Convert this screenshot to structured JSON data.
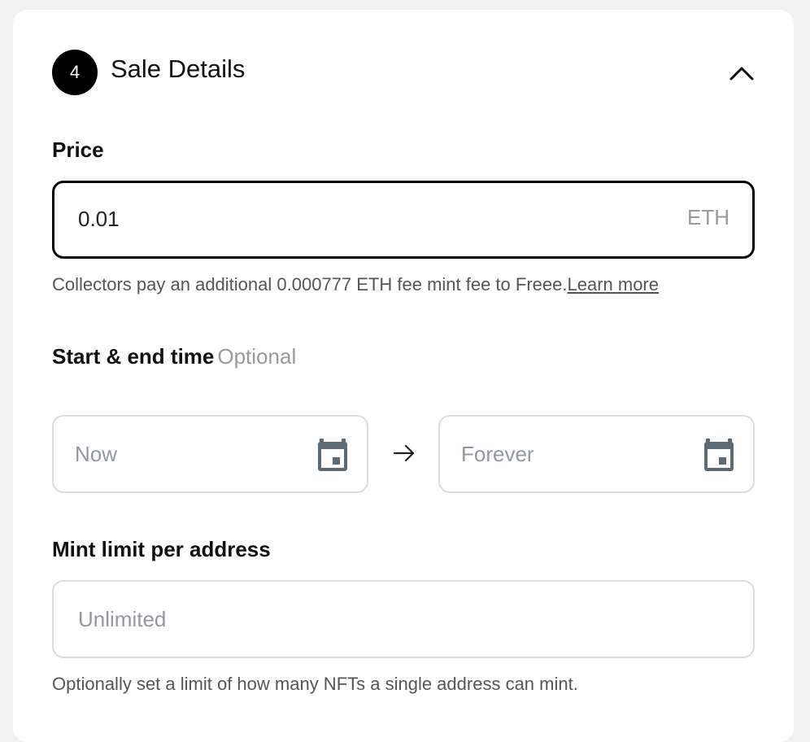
{
  "section": {
    "step_number": "4",
    "title": "Sale Details",
    "collapse_icon": "chevron-up-icon"
  },
  "price": {
    "label": "Price",
    "value": "0.01",
    "unit": "ETH",
    "helper_text": "Collectors pay an additional 0.000777 ETH fee mint fee to Freee.",
    "learn_more": "Learn more"
  },
  "schedule": {
    "label": "Start & end time",
    "optional_tag": "Optional",
    "start_placeholder": "Now",
    "end_placeholder": "Forever",
    "calendar_icon": "calendar-icon",
    "arrow_icon": "arrow-right-icon"
  },
  "mint_limit": {
    "label": "Mint limit per address",
    "placeholder": "Unlimited",
    "helper_text": "Optionally set a limit of how many NFTs a single address can mint."
  },
  "colors": {
    "accent": "#000000",
    "border": "#dcdcdc",
    "placeholder": "#8f98a3",
    "muted": "#9a9a9a"
  }
}
